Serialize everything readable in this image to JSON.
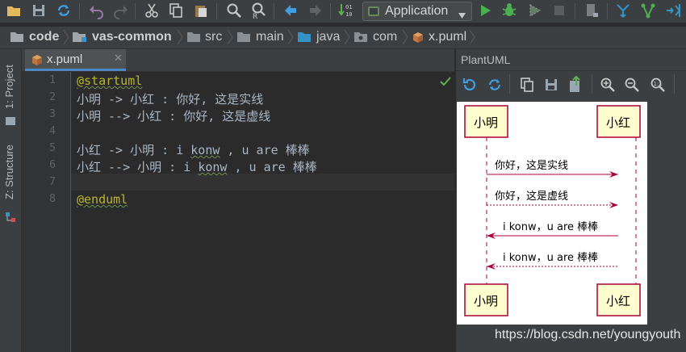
{
  "toolbar": {
    "icons": [
      "open-icon",
      "save-icon",
      "sync-icon",
      "undo-icon",
      "redo-icon",
      "cut-icon",
      "copy-icon",
      "paste-icon",
      "find-icon",
      "replace-icon",
      "back-icon",
      "forward-icon",
      "build-icon"
    ],
    "run_config_label": "Application",
    "run_icons": [
      "run-icon",
      "debug-icon",
      "coverage-icon",
      "stop-icon",
      "device-icon",
      "vcs-icon",
      "branch-icon",
      "update-icon"
    ],
    "accent_run": "#4caf50",
    "accent_vcs": "#3592c4"
  },
  "breadcrumb": {
    "items": [
      "code",
      "vas-common",
      "src",
      "main",
      "java",
      "com",
      "x.puml"
    ]
  },
  "left_strip": {
    "project_label": "1: Project",
    "structure_label": "Z: Structure"
  },
  "editor": {
    "tab_label": "x.puml",
    "line_numbers": [
      "1",
      "2",
      "3",
      "4",
      "5",
      "6",
      "7",
      "8"
    ],
    "lines": {
      "l1": "@startuml",
      "l2": "小明 -> 小红 : 你好, 这是实线",
      "l3": "小明 --> 小红 : 你好, 这是虚线",
      "l5a": "小红 -> 小明 : i ",
      "l5b": "konw",
      "l5c": " , u are 棒棒",
      "l6a": "小红 --> 小明 : i ",
      "l6b": "konw",
      "l6c": " , u are 棒棒",
      "l8": "@enduml"
    }
  },
  "plantuml": {
    "panel_title": "PlantUML",
    "participants": [
      "小明",
      "小红"
    ],
    "messages": [
      "你好，这是实线",
      "你好，这是虚线",
      "i konw，u are 棒棒",
      "i konw，u are 棒棒"
    ],
    "message_styles": [
      "solid",
      "dashed",
      "solid",
      "dashed"
    ],
    "message_directions": [
      "right",
      "right",
      "left",
      "left"
    ],
    "participant_fill": "#fefece",
    "participant_border": "#a80036",
    "arrow_color": "#a80036"
  },
  "watermark": "https://blog.csdn.net/youngyouth"
}
